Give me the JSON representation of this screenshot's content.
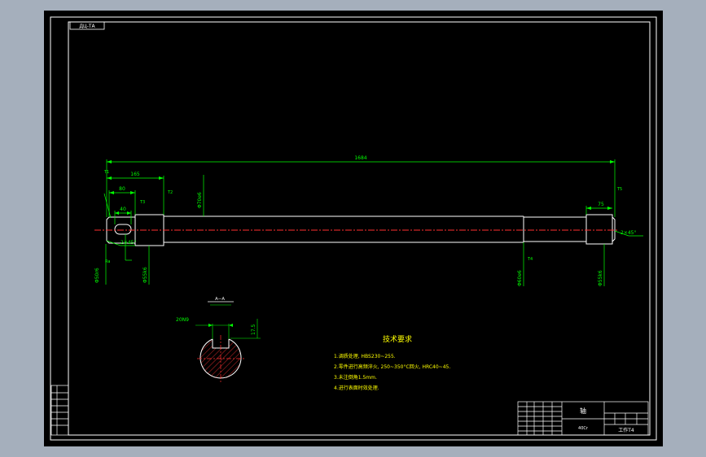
{
  "drawing": {
    "top_tag": "ДЦ-ТА",
    "dimensions": {
      "overall_length": "1684",
      "left_length": "165",
      "key_slot_length": "80",
      "key_width": "40",
      "right_length": "75",
      "chamfer_left": "2×45°",
      "chamfer_right": "2×45°",
      "dia_left_end": "Φ50r6",
      "dia_left_bearing": "Φ55k6",
      "dia_middle": "Φ70e6",
      "dia_right_body": "Φ60e6",
      "dia_right_end": "Φ55k6",
      "section_width": "20N9",
      "section_depth": "17.5",
      "section_label": "A—A",
      "ra": "Ra",
      "t1": "T1",
      "t2": "T2",
      "t3": "T3",
      "t4": "T4",
      "t5": "T5"
    },
    "tech_requirements": {
      "title": "技术要求",
      "items": [
        "1.调质处理, HBS230~255.",
        "2.零件进行高频淬火, 250~350°C回火, HRC40~45.",
        "3.未注倒角1.5mm.",
        "4.进行表面时效处理."
      ]
    },
    "title_block": {
      "part_name": "轴",
      "material": "40Cr",
      "stamp": "工作T4"
    }
  }
}
